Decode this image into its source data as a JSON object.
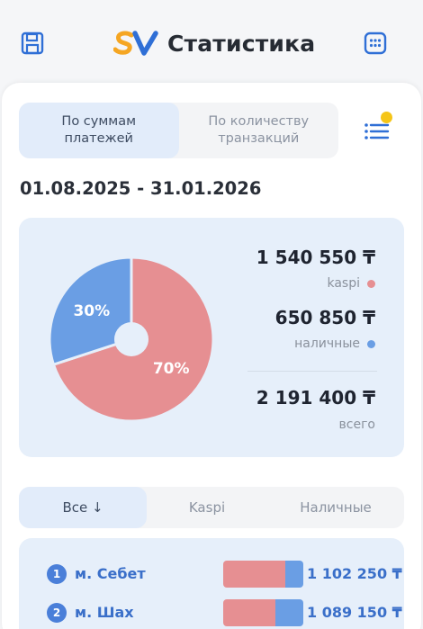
{
  "header": {
    "title": "Статистика",
    "left_icon": "save-icon",
    "right_icon": "calendar-icon"
  },
  "brand": {
    "logo_text": "SV",
    "colors": {
      "s": "#f5a623",
      "v": "#2f6fd6"
    }
  },
  "mode_tabs": [
    {
      "label": "По суммам\nплатежей",
      "active": true
    },
    {
      "label": "По количеству\nтранзакций",
      "active": false
    }
  ],
  "filter": {
    "icon": "filter-list-icon",
    "has_notification": true
  },
  "date_range": "01.08.2025 - 31.01.2026",
  "summary": {
    "kaspi": {
      "amount": "1 540 550 ₸",
      "label": "kaspi",
      "color": "#e68f92"
    },
    "cash": {
      "amount": "650 850 ₸",
      "label": "наличные",
      "color": "#6a9ee4"
    },
    "total": {
      "amount": "2 191 400 ₸",
      "label": "всего"
    }
  },
  "chart_data": {
    "type": "pie",
    "slices": [
      {
        "label": "70%",
        "value": 70,
        "color": "#e68f92"
      },
      {
        "label": "30%",
        "value": 30,
        "color": "#6a9ee4"
      }
    ]
  },
  "payment_tabs": [
    {
      "label": "Все ↓",
      "active": true
    },
    {
      "label": "Kaspi",
      "active": false
    },
    {
      "label": "Наличные",
      "active": false
    }
  ],
  "ranking": [
    {
      "rank": "1",
      "name": "м. Себет",
      "amount": "1 102 250 ₸",
      "kaspi_share": 0.78
    },
    {
      "rank": "2",
      "name": "м. Шах",
      "amount": "1 089 150 ₸",
      "kaspi_share": 0.65
    }
  ]
}
